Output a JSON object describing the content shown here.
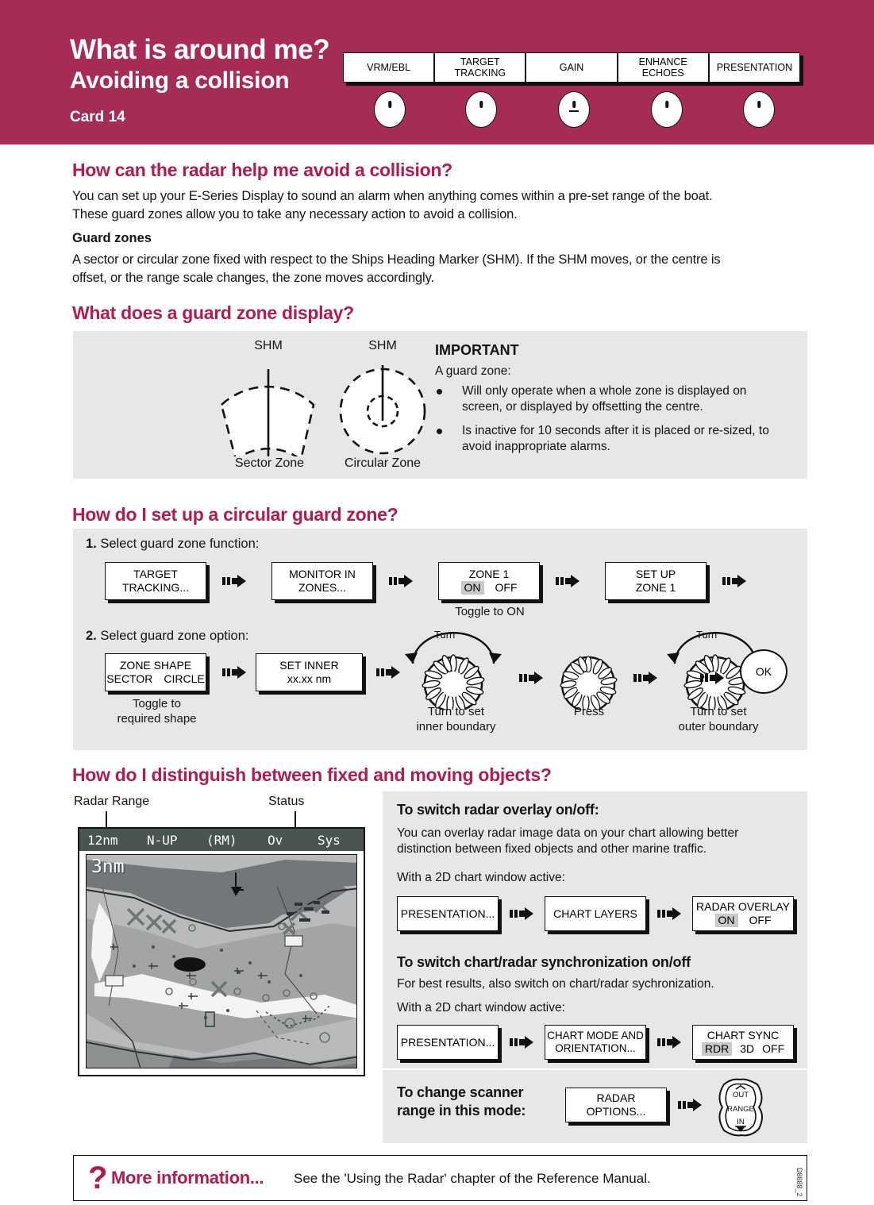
{
  "header": {
    "title": "What is around me?",
    "subtitle": "Avoiding a collision",
    "card": "Card 14",
    "softkeys": [
      {
        "label": "VRM/EBL",
        "icon": "softkey-nub"
      },
      {
        "label": "TARGET\nTRACKING",
        "line1": "TARGET",
        "line2": "TRACKING",
        "icon": "softkey-nub"
      },
      {
        "label": "GAIN",
        "icon": "softkey-nub-underline"
      },
      {
        "label": "ENHANCE\nECHOES",
        "line1": "ENHANCE",
        "line2": "ECHOES",
        "icon": "softkey-nub"
      },
      {
        "label": "PRESENTATION",
        "icon": "softkey-nub"
      }
    ]
  },
  "section1": {
    "heading": "How can the radar help me avoid a collision?",
    "para1_line1": "You can set up your E-Series Display to sound an alarm when anything comes within a pre-set range of the boat.",
    "para1_line2": "These guard zones allow you to take any necessary action to avoid a collision.",
    "subheading": "Guard zones",
    "para2_line1": "A sector or circular zone fixed with respect to the Ships Heading Marker (SHM).  If the SHM moves, or the centre is",
    "para2_line2": "offset, or the range scale changes, the zone moves accordingly."
  },
  "section2": {
    "heading": "What does a guard zone display?",
    "diagram": {
      "shm_label_left": "SHM",
      "shm_label_right": "SHM",
      "caption_left": "Sector Zone",
      "caption_right": "Circular Zone"
    },
    "important": {
      "title": "IMPORTANT",
      "intro": "A guard zone:",
      "bullets": [
        "Will only operate when a whole zone is displayed on screen, or displayed by offsetting the centre.",
        "Is inactive for 10 seconds after it is placed or re-sized, to avoid inappropriate alarms."
      ],
      "bullet1_line1": "Will only operate when a whole zone is displayed on",
      "bullet1_line2": "screen, or displayed by offsetting the centre.",
      "bullet2_line1": "Is inactive for 10 seconds after it is placed or re-sized, to",
      "bullet2_line2": "avoid inappropriate alarms."
    }
  },
  "section3": {
    "heading": "How do I set up a circular guard zone?",
    "step1_num": "1.",
    "step1_text": "Select guard zone function:",
    "step1_boxes": [
      {
        "line1": "TARGET",
        "line2": "TRACKING..."
      },
      {
        "line1": "MONITOR IN",
        "line2": "ZONES..."
      },
      {
        "line1": "ZONE 1",
        "opt_on": "ON",
        "opt_off": "OFF",
        "selected": "ON"
      },
      {
        "line1": "SET UP",
        "line2": "ZONE 1"
      }
    ],
    "step1_caption": "Toggle to ON",
    "step2_num": "2.",
    "step2_text": "Select guard zone option:",
    "step2_boxes": [
      {
        "line1": "ZONE SHAPE",
        "opt_a": "SECTOR",
        "opt_b": "CIRCLE"
      },
      {
        "line1": "SET INNER",
        "line2": "xx.xx nm"
      }
    ],
    "step2_caption_shape_line1": "Toggle to",
    "step2_caption_shape_line2": "required shape",
    "knob_turn_label": "Turn",
    "knob1_caption_line1": "Turn to set",
    "knob1_caption_line2": "inner boundary",
    "knob2_caption": "Press",
    "knob3_caption_line1": "Turn to set",
    "knob3_caption_line2": "outer boundary",
    "ok_label": "OK"
  },
  "section4": {
    "heading": "How do I distinguish between fixed and moving objects?",
    "annotations": {
      "radar_range": "Radar Range",
      "status": "Status"
    },
    "radar_display": {
      "range": "12nm",
      "orientation": "N-UP",
      "mode": "(RM)",
      "overlay": "Ov",
      "system": "Sys",
      "ring_range": "3nm"
    },
    "overlay_block": {
      "title": "To switch radar overlay on/off:",
      "text_line1": "You can overlay radar image data on your chart allowing better",
      "text_line2": "distinction between fixed objects and other marine traffic.",
      "prompt": "With a 2D chart window active:",
      "boxes": [
        {
          "line1": "PRESENTATION..."
        },
        {
          "line1": "CHART LAYERS"
        },
        {
          "line1": "RADAR OVERLAY",
          "opt_on": "ON",
          "opt_off": "OFF",
          "selected": "ON"
        }
      ]
    },
    "sync_block": {
      "title": "To switch chart/radar synchronization on/off",
      "text_line1": "For best results, also switch on chart/radar sychronization.",
      "prompt": "With a 2D chart window active:",
      "boxes": [
        {
          "line1": "PRESENTATION..."
        },
        {
          "line1": "CHART MODE AND",
          "line2": "ORIENTATION..."
        },
        {
          "line1": "CHART SYNC",
          "opt_a": "RDR",
          "opt_b": "3D",
          "opt_c": "OFF",
          "selected": "RDR"
        }
      ]
    },
    "scanner_block": {
      "title_line1": "To change scanner",
      "title_line2": "range in this mode:",
      "box_line1": "RADAR",
      "box_line2": "OPTIONS...",
      "rocker": {
        "out": "OUT",
        "range": "RANGE",
        "in": "IN"
      }
    }
  },
  "footer": {
    "question_mark": "?",
    "more_info": "More information...",
    "text": "See the 'Using the Radar' chapter of the Reference Manual.",
    "doc_code": "D8888_2"
  },
  "colors": {
    "brand_maroon": "#A62C53",
    "heading_red": "#B01C4E",
    "panel_grey": "#E6E7E8",
    "radar_bar": "#4A5450"
  }
}
